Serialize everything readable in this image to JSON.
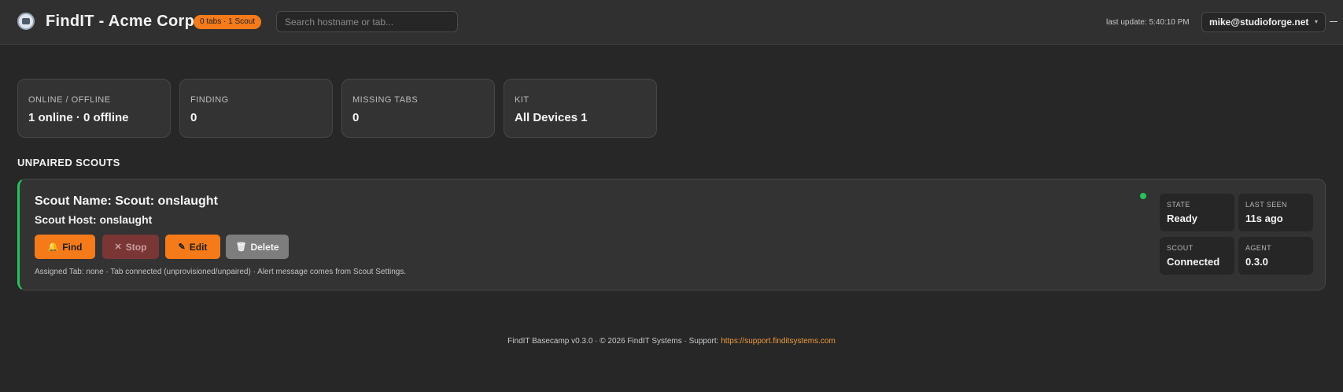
{
  "header": {
    "app_title": "FindIT - Acme Corp",
    "count_badge": "0 tabs · 1 Scout",
    "search_placeholder": "Search hostname or tab...",
    "last_update": "last update: 5:40:10 PM",
    "user_email": "mike@studioforge.net",
    "user_caret": "▾"
  },
  "stats": [
    {
      "label": "ONLINE / OFFLINE",
      "value": "1 online · 0 offline"
    },
    {
      "label": "FINDING",
      "value": "0"
    },
    {
      "label": "MISSING TABS",
      "value": "0"
    },
    {
      "label": "KIT",
      "value": "All Devices 1"
    }
  ],
  "section_title": "UNPAIRED SCOUTS",
  "scout": {
    "name": "Scout Name: Scout: onslaught",
    "host": "Scout Host: onslaught",
    "buttons": {
      "find": {
        "icon": "🔔",
        "label": "Find"
      },
      "stop": {
        "icon": "✕",
        "label": "Stop"
      },
      "edit": {
        "icon": "✎",
        "label": "Edit"
      },
      "delete": {
        "icon": "🗑",
        "label": "Delete"
      }
    },
    "assigned_text": "Assigned Tab: none · Tab connected (unprovisioned/unpaired) · Alert message comes from Scout Settings.",
    "status_color": "#26c35a",
    "meta": {
      "state": {
        "label": "STATE",
        "value": "Ready"
      },
      "last_seen": {
        "label": "LAST SEEN",
        "value": "11s ago"
      },
      "scout": {
        "label": "SCOUT",
        "value": "Connected"
      },
      "agent": {
        "label": "AGENT",
        "value": "0.3.0"
      }
    }
  },
  "footer": {
    "text": "FindIT Basecamp v0.3.0 · © 2026 FindIT Systems · Support: ",
    "link": "https://support.finditsystems.com"
  },
  "colors": {
    "accent": "#f47a1a",
    "online": "#26c35a",
    "background": "#272727",
    "card": "#333333"
  }
}
